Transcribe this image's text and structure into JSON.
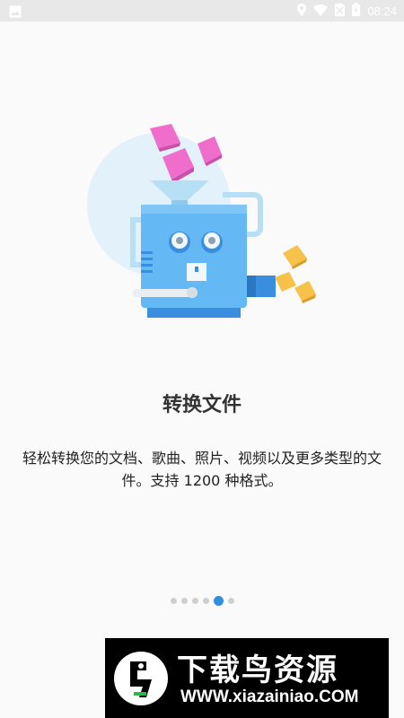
{
  "status_bar": {
    "time": "08:24",
    "icons": [
      "image-icon",
      "location-icon",
      "wifi-icon",
      "no-sim-icon",
      "battery-icon"
    ]
  },
  "onboarding": {
    "title": "转换文件",
    "description": "轻松转换您的文档、歌曲、照片、视频以及更多类型的文件。支持 1200 种格式。",
    "pages": {
      "total": 6,
      "current": 5
    }
  },
  "colors": {
    "machine_blue": "#64b9f5",
    "cube_pink": "#f06ecb",
    "cube_yellow": "#f6c24a",
    "dot_active": "#2f8fe0"
  },
  "watermark": {
    "title": "下载鸟资源",
    "url": "WWW.xiazainiao.COM"
  }
}
